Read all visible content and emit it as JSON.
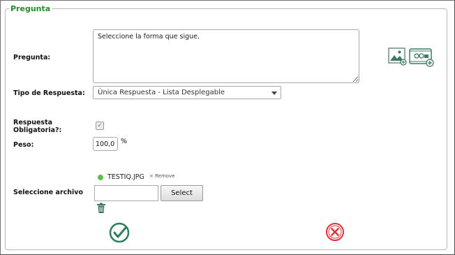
{
  "form": {
    "legend": "Pregunta",
    "pregunta_label": "Pregunta:",
    "pregunta_value": "Seleccione la forma que sigue.",
    "tipo_label": "Tipo de Respuesta:",
    "tipo_value": "Única Respuesta - Lista Desplegable",
    "obligatoria_label_line1": "Respuesta",
    "obligatoria_label_line2": "Obligatoria?:",
    "obligatoria_checked": true,
    "peso_label": "Peso:",
    "peso_value": "100,00",
    "peso_unit": "%",
    "archivo_label": "Seleccione archivo",
    "file_name": "TESTIQ.JPG",
    "remove_label": "Remove",
    "select_button": "Select"
  },
  "icons": {
    "add_image": "add-image-icon",
    "add_video": "add-video-icon",
    "delete": "trash-icon",
    "confirm": "check-circle-icon",
    "cancel": "x-circle-icon"
  },
  "colors": {
    "legend": "#2a8a2a",
    "status_dot": "#5cc04a",
    "confirm": "#2e7d5b",
    "cancel": "#e0303a"
  }
}
